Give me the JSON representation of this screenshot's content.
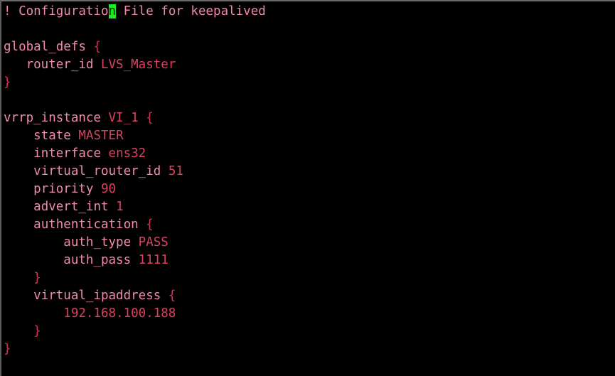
{
  "editor": {
    "cursor": {
      "line_index": 0,
      "column_index": 16,
      "character": "n",
      "block_color": "#16f016",
      "glyph_color": "#0a2d0a"
    },
    "background_color": "#000000",
    "default_text_color": "#f07a9a",
    "keyword_color": "#f08ba6",
    "value_color": "#d9415f",
    "brace_color": "#cf3350"
  },
  "lines": [
    {
      "index": 0,
      "text": "! Configuration File for keepalived",
      "parts": [
        {
          "kind": "comment",
          "text": "! Configuratio"
        },
        {
          "kind": "cursor",
          "text": "n"
        },
        {
          "kind": "comment",
          "text": " File for keepalived"
        }
      ]
    },
    {
      "index": 1,
      "text": "",
      "parts": [
        {
          "kind": "plain",
          "text": " "
        }
      ]
    },
    {
      "index": 2,
      "text": "global_defs {",
      "parts": [
        {
          "kind": "kw",
          "text": "global_defs"
        },
        {
          "kind": "plain",
          "text": " "
        },
        {
          "kind": "brace",
          "text": "{"
        }
      ]
    },
    {
      "index": 3,
      "text": "   router_id LVS_Master",
      "parts": [
        {
          "kind": "plain",
          "text": "   "
        },
        {
          "kind": "kw",
          "text": "router_id"
        },
        {
          "kind": "plain",
          "text": " "
        },
        {
          "kind": "val",
          "text": "LVS_Master"
        }
      ]
    },
    {
      "index": 4,
      "text": "}",
      "parts": [
        {
          "kind": "brace",
          "text": "}"
        }
      ]
    },
    {
      "index": 5,
      "text": "",
      "parts": [
        {
          "kind": "plain",
          "text": " "
        }
      ]
    },
    {
      "index": 6,
      "text": "vrrp_instance VI_1 {",
      "parts": [
        {
          "kind": "kw",
          "text": "vrrp_instance"
        },
        {
          "kind": "plain",
          "text": " "
        },
        {
          "kind": "val",
          "text": "VI_1"
        },
        {
          "kind": "plain",
          "text": " "
        },
        {
          "kind": "brace",
          "text": "{"
        }
      ]
    },
    {
      "index": 7,
      "text": "    state MASTER",
      "parts": [
        {
          "kind": "plain",
          "text": "    "
        },
        {
          "kind": "kw",
          "text": "state"
        },
        {
          "kind": "plain",
          "text": " "
        },
        {
          "kind": "val",
          "text": "MASTER"
        }
      ]
    },
    {
      "index": 8,
      "text": "    interface ens32",
      "parts": [
        {
          "kind": "plain",
          "text": "    "
        },
        {
          "kind": "kw",
          "text": "interface"
        },
        {
          "kind": "plain",
          "text": " "
        },
        {
          "kind": "val",
          "text": "ens32"
        }
      ]
    },
    {
      "index": 9,
      "text": "    virtual_router_id 51",
      "parts": [
        {
          "kind": "plain",
          "text": "    "
        },
        {
          "kind": "kw",
          "text": "virtual_router_id"
        },
        {
          "kind": "plain",
          "text": " "
        },
        {
          "kind": "val",
          "text": "51"
        }
      ]
    },
    {
      "index": 10,
      "text": "    priority 90",
      "parts": [
        {
          "kind": "plain",
          "text": "    "
        },
        {
          "kind": "kw",
          "text": "priority"
        },
        {
          "kind": "plain",
          "text": " "
        },
        {
          "kind": "val",
          "text": "90"
        }
      ]
    },
    {
      "index": 11,
      "text": "    advert_int 1",
      "parts": [
        {
          "kind": "plain",
          "text": "    "
        },
        {
          "kind": "kw",
          "text": "advert_int"
        },
        {
          "kind": "plain",
          "text": " "
        },
        {
          "kind": "val",
          "text": "1"
        }
      ]
    },
    {
      "index": 12,
      "text": "    authentication {",
      "parts": [
        {
          "kind": "plain",
          "text": "    "
        },
        {
          "kind": "kw",
          "text": "authentication"
        },
        {
          "kind": "plain",
          "text": " "
        },
        {
          "kind": "brace",
          "text": "{"
        }
      ]
    },
    {
      "index": 13,
      "text": "        auth_type PASS",
      "parts": [
        {
          "kind": "plain",
          "text": "        "
        },
        {
          "kind": "kw",
          "text": "auth_type"
        },
        {
          "kind": "plain",
          "text": " "
        },
        {
          "kind": "val",
          "text": "PASS"
        }
      ]
    },
    {
      "index": 14,
      "text": "        auth_pass 1111",
      "parts": [
        {
          "kind": "plain",
          "text": "        "
        },
        {
          "kind": "kw",
          "text": "auth_pass"
        },
        {
          "kind": "plain",
          "text": " "
        },
        {
          "kind": "val",
          "text": "1111"
        }
      ]
    },
    {
      "index": 15,
      "text": "    }",
      "parts": [
        {
          "kind": "plain",
          "text": "    "
        },
        {
          "kind": "brace",
          "text": "}"
        }
      ]
    },
    {
      "index": 16,
      "text": "    virtual_ipaddress {",
      "parts": [
        {
          "kind": "plain",
          "text": "    "
        },
        {
          "kind": "kw",
          "text": "virtual_ipaddress"
        },
        {
          "kind": "plain",
          "text": " "
        },
        {
          "kind": "brace",
          "text": "{"
        }
      ]
    },
    {
      "index": 17,
      "text": "        192.168.100.188",
      "parts": [
        {
          "kind": "plain",
          "text": "        "
        },
        {
          "kind": "val",
          "text": "192.168.100.188"
        }
      ]
    },
    {
      "index": 18,
      "text": "    }",
      "parts": [
        {
          "kind": "plain",
          "text": "    "
        },
        {
          "kind": "brace",
          "text": "}"
        }
      ]
    },
    {
      "index": 19,
      "text": "}",
      "parts": [
        {
          "kind": "brace",
          "text": "}"
        }
      ]
    }
  ]
}
